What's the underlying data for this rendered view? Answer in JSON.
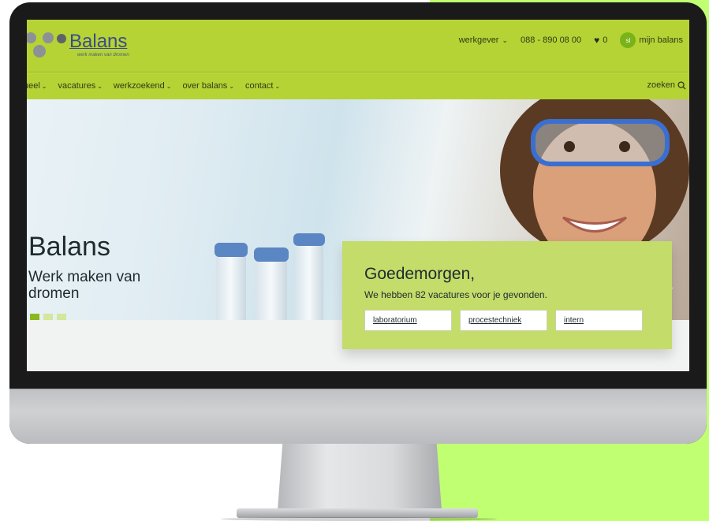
{
  "site": {
    "logo": {
      "name": "Balans",
      "tagline": "werk maken van dromen"
    },
    "top_bar": {
      "employer_label": "werkgever",
      "phone": "088 - 890 08 00",
      "favorites_count": "0",
      "avatar_initials": "sl",
      "account_label": "mijn balans"
    },
    "nav": {
      "items": [
        {
          "label": "ueel"
        },
        {
          "label": "vacatures"
        },
        {
          "label": "werkzoekend"
        },
        {
          "label": "over balans"
        },
        {
          "label": "contact"
        }
      ],
      "search_label": "zoeken"
    },
    "hero": {
      "title": "Balans",
      "subtitle": "Werk maken van dromen",
      "slides": 3,
      "active_slide": 1
    },
    "welcome_card": {
      "greeting": "Goedemorgen,",
      "text": "We hebben 82 vacatures voor je gevonden.",
      "tags": [
        {
          "label": "laboratorium"
        },
        {
          "label": "procestechniek"
        },
        {
          "label": "intern"
        }
      ]
    }
  },
  "colors": {
    "brand_green": "#b5d334",
    "card_green": "#c3dc6a",
    "background_accent": "#c1ff72",
    "logo_blue": "#3a4b8c"
  }
}
